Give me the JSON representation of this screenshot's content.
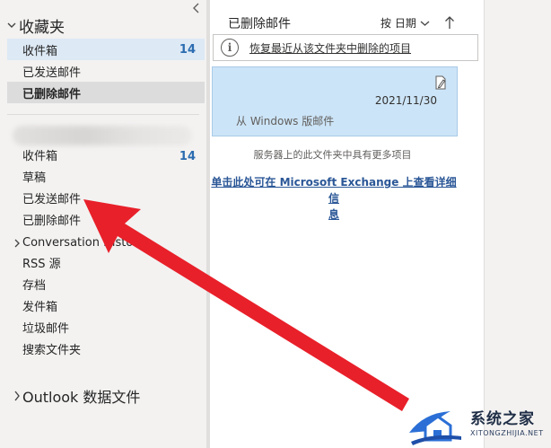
{
  "folder_pane": {
    "favorites": {
      "label": "收藏夹",
      "items": [
        {
          "label": "收件箱",
          "count": "14"
        },
        {
          "label": "已发送邮件",
          "count": ""
        },
        {
          "label": "已删除邮件",
          "count": ""
        }
      ]
    },
    "account": {
      "items": [
        {
          "label": "收件箱",
          "count": "14"
        },
        {
          "label": "草稿"
        },
        {
          "label": "已发送邮件"
        },
        {
          "label": "已删除邮件"
        },
        {
          "label": "Conversation History"
        },
        {
          "label": "RSS 源"
        },
        {
          "label": "存档"
        },
        {
          "label": "发件箱"
        },
        {
          "label": "垃圾邮件"
        },
        {
          "label": "搜索文件夹"
        }
      ]
    },
    "data_file": {
      "label": "Outlook 数据文件"
    }
  },
  "message_list": {
    "title": "已删除邮件",
    "sort_label": "按 日期",
    "restore_link": "恢复最近从该文件夹中删除的项目",
    "item": {
      "date": "2021/11/30",
      "preview": "从 Windows 版邮件"
    },
    "server_note": "服务器上的此文件夹中具有更多项目",
    "exchange_link_line1": "单击此处可在 Microsoft Exchange 上查看详细信",
    "exchange_link_line2": "息"
  },
  "watermark": {
    "text": "系统之家",
    "sub": "XITONGZHIJIA.NET"
  },
  "colors": {
    "count": "#2b6cb0",
    "selection": "#cce4f7",
    "arrow": "#e8202a",
    "link": "#2b5797"
  }
}
